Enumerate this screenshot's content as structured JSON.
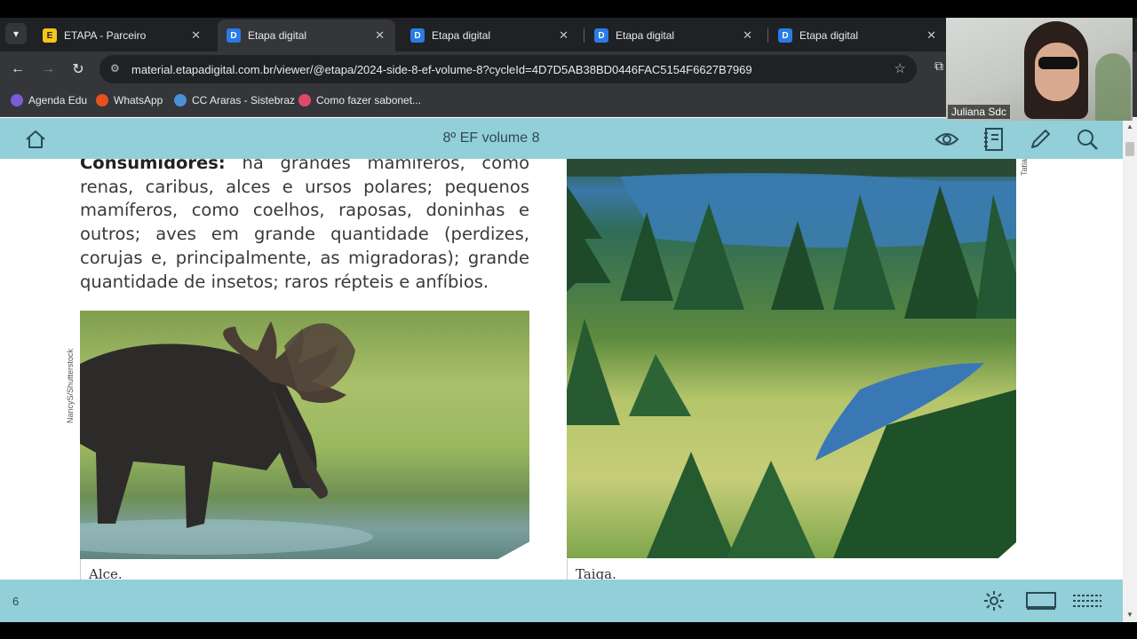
{
  "browser": {
    "tabs": [
      {
        "title": "ETAPA - Parceiro",
        "icon": "etapa-favicon"
      },
      {
        "title": "Etapa digital",
        "icon": "etapa-digital-favicon",
        "active": true
      },
      {
        "title": "Etapa digital",
        "icon": "etapa-digital-favicon"
      },
      {
        "title": "Etapa digital",
        "icon": "etapa-digital-favicon"
      },
      {
        "title": "Etapa digital",
        "icon": "etapa-digital-favicon"
      }
    ],
    "url": "material.etapadigital.com.br/viewer/@etapa/2024-side-8-ef-volume-8?cycleId=4D7D5AB38BD0446FAC5154F6627B7969",
    "bookmarks": [
      {
        "label": "Agenda Edu",
        "color": "#7b5cd6"
      },
      {
        "label": "WhatsApp",
        "color": "#e8501f"
      },
      {
        "label": "CC Araras - Sistebraz",
        "color": "#4a90d9"
      },
      {
        "label": "Como fazer sabonet...",
        "color": "#e04a6a"
      }
    ]
  },
  "webcam": {
    "name": "Juliana Sdc"
  },
  "header": {
    "title": "8º EF volume 8"
  },
  "content": {
    "consumers_label": "Consumidores:",
    "consumers_text": " há grandes mamíferos, como renas, caribus, alces e ursos polares; pequenos mamíferos, como coelhos, raposas, doninhas e outros; aves em grande quantidade (perdizes, corujas e, principalmente, as migradoras); grande quantidade de insetos; raros répteis e anfíbios.",
    "credit_left": "NancyS/Shutterstock",
    "credit_right": "Tatia",
    "caption_left": "Alce.",
    "caption_right": "Taiga."
  },
  "footer": {
    "page_number": "6"
  },
  "colors": {
    "app_bar": "#92cfd8",
    "icon": "#2b4b55"
  }
}
